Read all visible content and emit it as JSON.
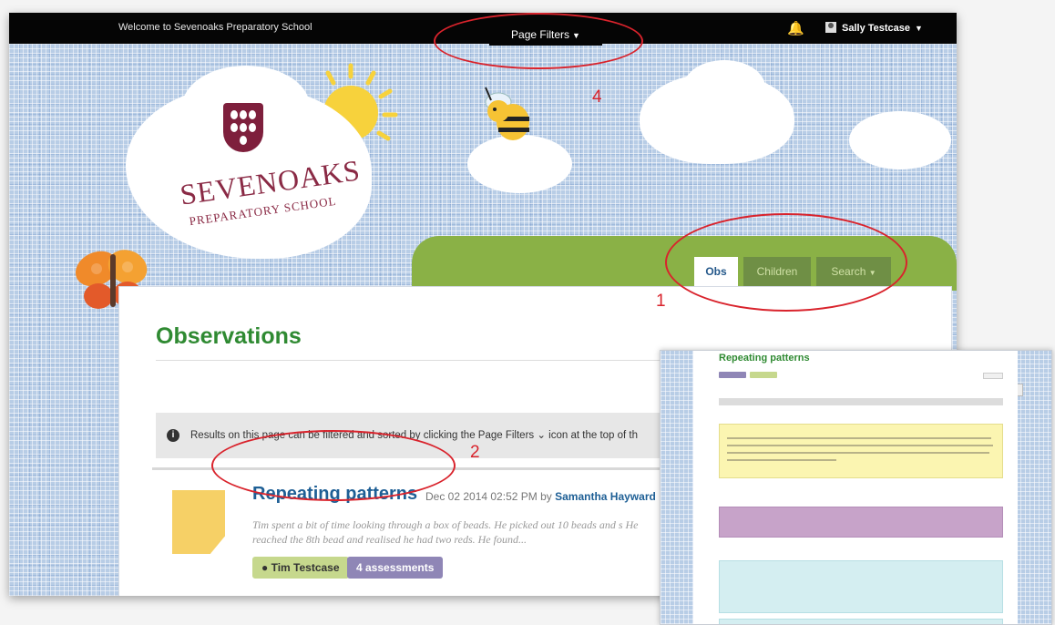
{
  "topbar": {
    "welcome": "Welcome to Sevenoaks Preparatory School",
    "filters_label": "Page Filters",
    "user_name": "Sally Testcase"
  },
  "header": {
    "school_name": "SEVENOAKS",
    "school_subname": "PREPARATORY SCHOOL"
  },
  "tabs": [
    {
      "label": "Obs",
      "active": true
    },
    {
      "label": "Children",
      "active": false
    },
    {
      "label": "Search",
      "active": false
    }
  ],
  "main": {
    "title": "Observations",
    "info_text": "Results on this page can be filtered and sorted by clicking the Page Filters ⌄ icon at the top of th"
  },
  "observation": {
    "title": "Repeating patterns",
    "date": "Dec 02 2014 02:52 PM by",
    "author": "Samantha Hayward",
    "excerpt": "Tim spent a bit of time looking through a box of beads. He picked out 10 beads and s He reached the 8th bead and realised he had two reds. He found...",
    "child_tag": "Tim Testcase",
    "assessments_tag": "4 assessments"
  },
  "annotations": [
    "1",
    "2",
    "4"
  ],
  "inset": {
    "title": "Repeating patterns"
  },
  "colors": {
    "accent_green": "#2f8a32",
    "link_blue": "#1e5f95",
    "annotation_red": "#d9232c",
    "assessment_purple": "#8f86b6",
    "child_green": "#c6d88d"
  }
}
